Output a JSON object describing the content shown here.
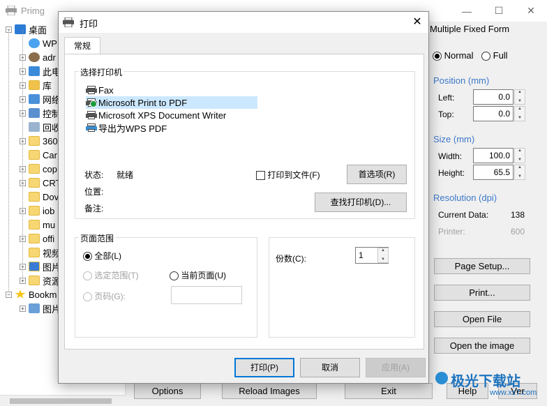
{
  "main": {
    "title": "Primg",
    "controls": {
      "minimize": "—",
      "maximize": "☐",
      "close": "✕"
    }
  },
  "tree": {
    "items": [
      {
        "label": "桌面",
        "indent": 0,
        "icon": "desktop-icon",
        "expander": "−"
      },
      {
        "label": "WP",
        "indent": 1,
        "icon": "cloud-icon",
        "expander": ""
      },
      {
        "label": "adr",
        "indent": 1,
        "icon": "user-icon",
        "expander": "+"
      },
      {
        "label": "此电",
        "indent": 1,
        "icon": "computer-icon",
        "expander": "+"
      },
      {
        "label": "库",
        "indent": 1,
        "icon": "library-folder-icon",
        "expander": "+"
      },
      {
        "label": "网络",
        "indent": 1,
        "icon": "network-icon",
        "expander": "+"
      },
      {
        "label": "控制",
        "indent": 1,
        "icon": "control-panel-icon",
        "expander": "+"
      },
      {
        "label": "回收",
        "indent": 1,
        "icon": "recycle-bin-icon",
        "expander": ""
      },
      {
        "label": "360",
        "indent": 1,
        "icon": "folder-icon",
        "expander": "+"
      },
      {
        "label": "Car",
        "indent": 1,
        "icon": "folder-icon",
        "expander": ""
      },
      {
        "label": "cop",
        "indent": 1,
        "icon": "folder-icon",
        "expander": "+"
      },
      {
        "label": "CRT",
        "indent": 1,
        "icon": "folder-icon",
        "expander": "+"
      },
      {
        "label": "Dov",
        "indent": 1,
        "icon": "folder-icon",
        "expander": ""
      },
      {
        "label": "iob",
        "indent": 1,
        "icon": "folder-icon",
        "expander": "+"
      },
      {
        "label": "mu",
        "indent": 1,
        "icon": "folder-icon",
        "expander": ""
      },
      {
        "label": "offi",
        "indent": 1,
        "icon": "folder-icon",
        "expander": "+"
      },
      {
        "label": "视频",
        "indent": 1,
        "icon": "folder-icon",
        "expander": ""
      },
      {
        "label": "图片",
        "indent": 1,
        "icon": "shield-folder-icon",
        "expander": "+"
      },
      {
        "label": "资源",
        "indent": 1,
        "icon": "folder-icon",
        "expander": "+"
      },
      {
        "label": "Bookm",
        "indent": 0,
        "icon": "star-icon",
        "expander": "−"
      },
      {
        "label": "图片",
        "indent": 1,
        "icon": "image-icon",
        "expander": "+"
      }
    ]
  },
  "right_panel": {
    "header": "Multiple Fixed Form",
    "mode_normal": "Normal",
    "mode_full": "Full",
    "position_title": "Position (mm)",
    "left_label": "Left:",
    "left_value": "0.0",
    "top_label": "Top:",
    "top_value": "0.0",
    "size_title": "Size (mm)",
    "width_label": "Width:",
    "width_value": "100.0",
    "height_label": "Height:",
    "height_value": "65.5",
    "resolution_title": "Resolution (dpi)",
    "current_label": "Current Data:",
    "current_value": "138",
    "printer_label": "Printer:",
    "printer_value": "600",
    "btn_page_setup": "Page Setup...",
    "btn_print": "Print...",
    "btn_open_file": "Open File",
    "btn_open_image": "Open the image"
  },
  "bottom_bar": {
    "options": "Options",
    "reload": "Reload Images",
    "exit": "Exit",
    "help": "Help",
    "ver": "Ver"
  },
  "dialog": {
    "title": "打印",
    "close": "✕",
    "tab": "常规",
    "select_printer_title": "选择打印机",
    "printers": [
      "Fax",
      "Microsoft Print to PDF",
      "Microsoft XPS Document Writer",
      "导出为WPS PDF"
    ],
    "status_label": "状态:",
    "status_value": "就绪",
    "location_label": "位置:",
    "comment_label": "备注:",
    "print_to_file": "打印到文件(F)",
    "preferences": "首选项(R)",
    "find_printer": "查找打印机(D)...",
    "page_range_title": "页面范围",
    "range_all": "全部(L)",
    "range_selection": "选定范围(T)",
    "range_current": "当前页面(U)",
    "range_pages": "页码(G):",
    "copies_label": "份数(C):",
    "copies_value": "1",
    "btn_print": "打印(P)",
    "btn_cancel": "取消",
    "btn_apply": "应用(A)"
  },
  "watermark": {
    "text": "极光下载站",
    "url": "www.xz7.com"
  }
}
